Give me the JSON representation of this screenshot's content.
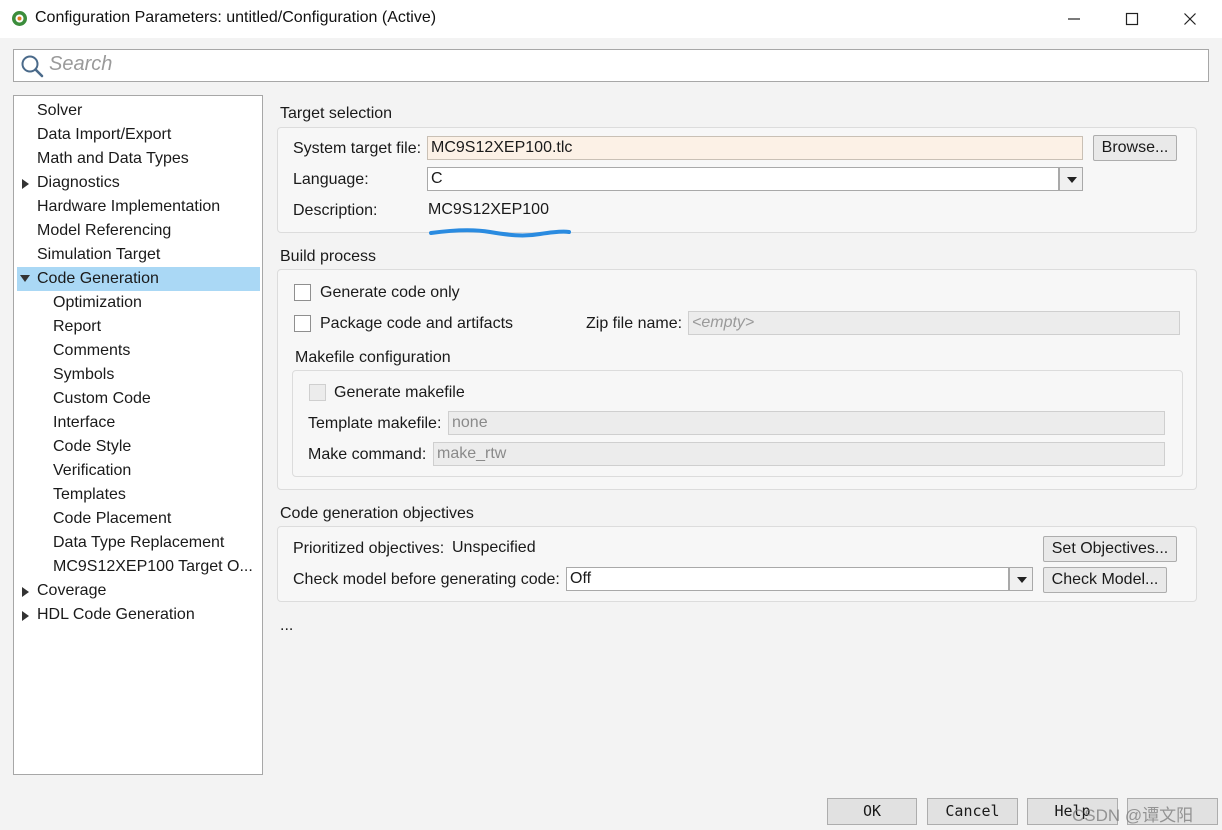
{
  "window": {
    "title": "Configuration Parameters: untitled/Configuration (Active)"
  },
  "search": {
    "placeholder": "Search"
  },
  "tree": {
    "items": [
      {
        "label": "Solver"
      },
      {
        "label": "Data Import/Export"
      },
      {
        "label": "Math and Data Types"
      },
      {
        "label": "Diagnostics"
      },
      {
        "label": "Hardware Implementation"
      },
      {
        "label": "Model Referencing"
      },
      {
        "label": "Simulation Target"
      },
      {
        "label": "Code Generation"
      },
      {
        "label": "Optimization"
      },
      {
        "label": "Report"
      },
      {
        "label": "Comments"
      },
      {
        "label": "Symbols"
      },
      {
        "label": "Custom Code"
      },
      {
        "label": "Interface"
      },
      {
        "label": "Code Style"
      },
      {
        "label": "Verification"
      },
      {
        "label": "Templates"
      },
      {
        "label": "Code Placement"
      },
      {
        "label": "Data Type Replacement"
      },
      {
        "label": "MC9S12XEP100 Target O..."
      },
      {
        "label": "Coverage"
      },
      {
        "label": "HDL Code Generation"
      }
    ],
    "selected": "Code Generation"
  },
  "target_selection": {
    "title": "Target selection",
    "system_target_file_label": "System target file:",
    "system_target_file_value": "MC9S12XEP100.tlc",
    "browse_label": "Browse...",
    "language_label": "Language:",
    "language_value": "C",
    "description_label": "Description:",
    "description_value": "MC9S12XEP100"
  },
  "build_process": {
    "title": "Build process",
    "generate_code_only_label": "Generate code only",
    "package_code_label": "Package code and artifacts",
    "zip_file_label": "Zip file name:",
    "zip_file_placeholder": "<empty>",
    "makefile_title": "Makefile configuration",
    "generate_makefile_label": "Generate makefile",
    "template_makefile_label": "Template makefile:",
    "template_makefile_value": "none",
    "make_command_label": "Make command:",
    "make_command_value": "make_rtw"
  },
  "objectives": {
    "title": "Code generation objectives",
    "prioritized_label": "Prioritized objectives:",
    "prioritized_value": "Unspecified",
    "set_objectives_label": "Set Objectives...",
    "check_model_label": "Check model before generating code:",
    "check_model_value": "Off",
    "check_model_button": "Check Model..."
  },
  "more_label": "...",
  "footer": {
    "ok_label": "OK",
    "cancel_label": "Cancel",
    "help_label": "Help",
    "watermark": "CSDN @谭文阳"
  },
  "colors": {
    "selection": "#aad8f5",
    "highlight_field": "#fcf1e6",
    "annotation_stroke": "#2a8be0"
  }
}
